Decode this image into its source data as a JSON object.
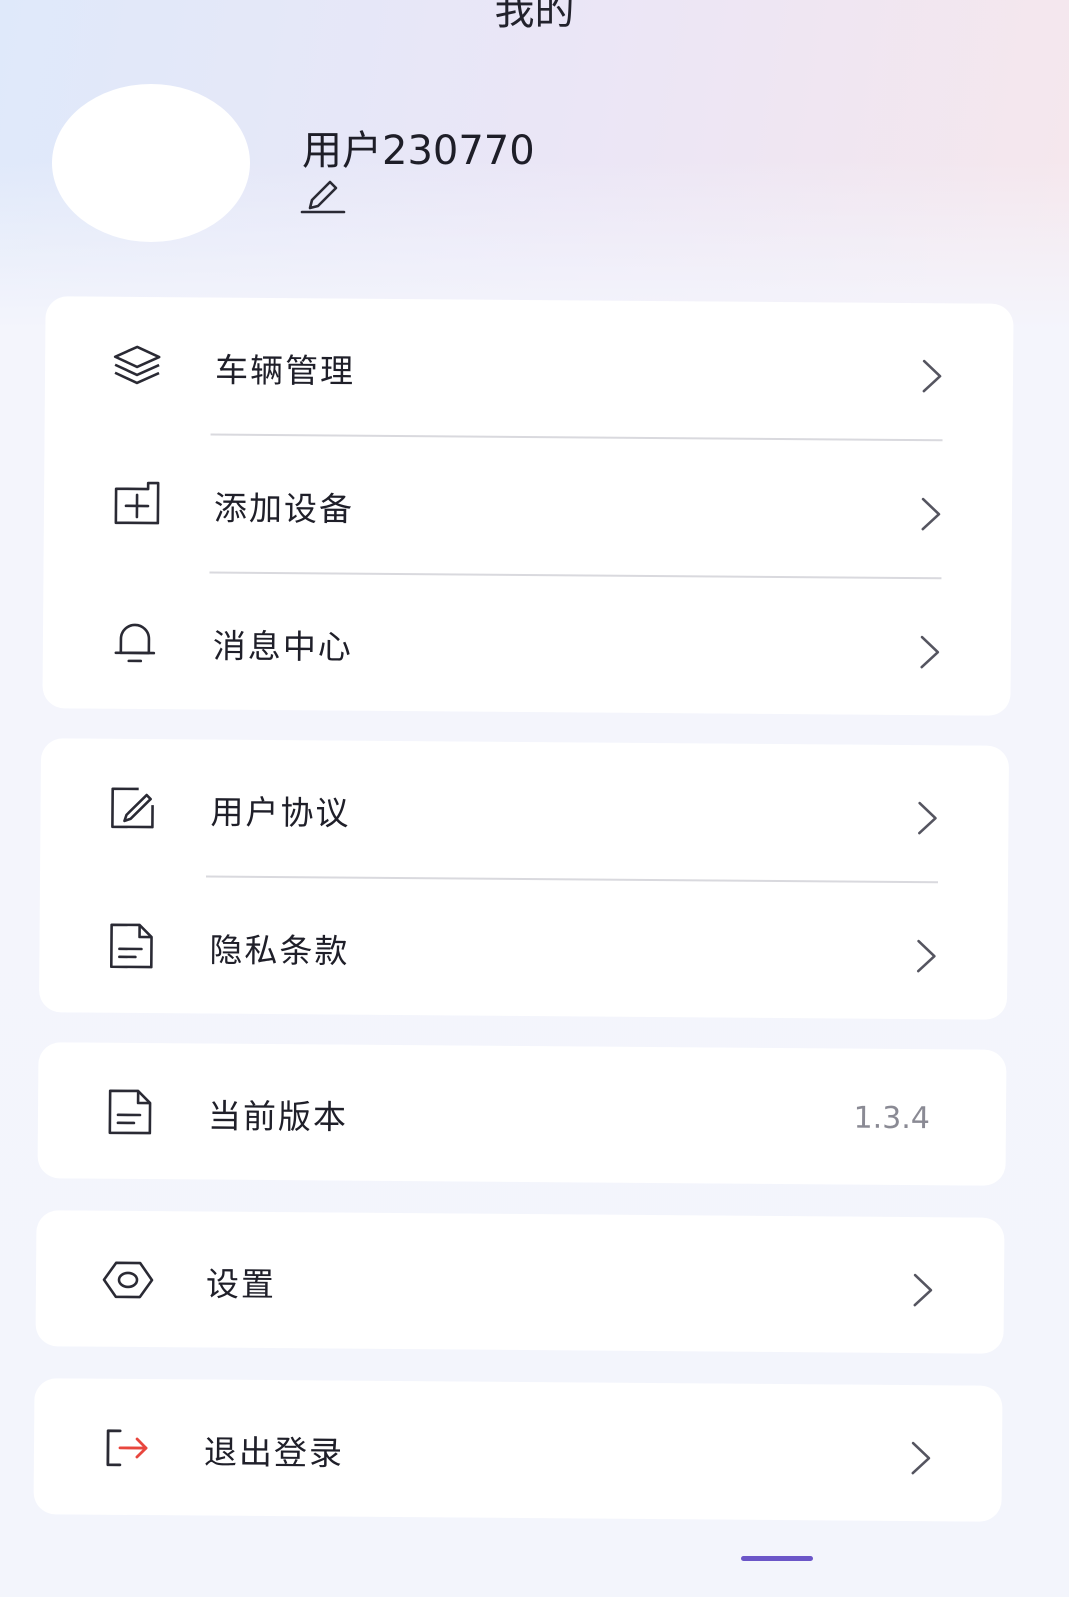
{
  "header": {
    "title": "我的"
  },
  "profile": {
    "username": "用户230770"
  },
  "menu": {
    "vehicle_manage": "车辆管理",
    "add_device": "添加设备",
    "message_center": "消息中心",
    "user_agreement": "用户协议",
    "privacy_policy": "隐私条款",
    "current_version": "当前版本",
    "version_value": "1.3.4",
    "settings": "设置",
    "logout": "退出登录"
  },
  "colors": {
    "logout_arrow": "#e8463e",
    "home_indicator": "#6b56c8"
  },
  "icons": {
    "vehicle_manage": "layers-icon",
    "add_device": "add-box-icon",
    "message_center": "bell-icon",
    "user_agreement": "edit-document-icon",
    "privacy_policy": "document-icon",
    "current_version": "document-icon",
    "settings": "hexagon-settings-icon",
    "logout": "logout-icon",
    "edit_profile": "pencil-icon"
  }
}
